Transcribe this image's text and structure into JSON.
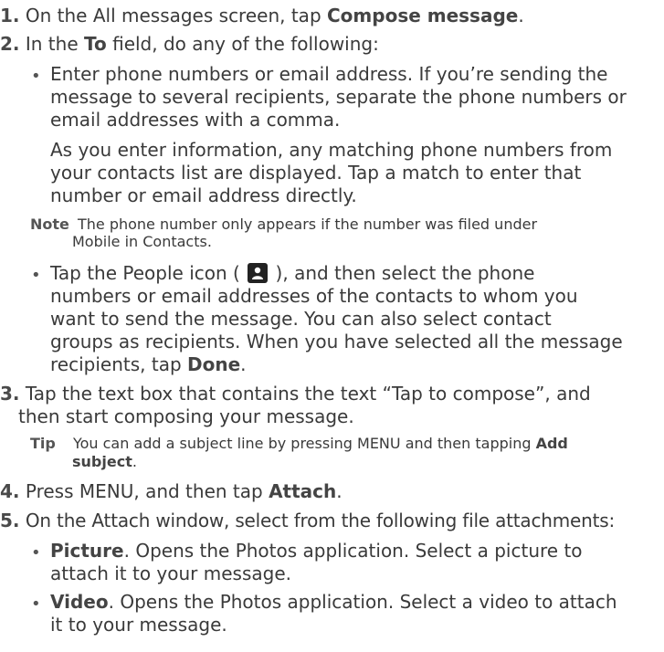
{
  "steps": {
    "s1_num": "1.",
    "s1_a": "On the All messages screen, tap ",
    "s1_b": "Compose message",
    "s1_c": ".",
    "s2_num": "2.",
    "s2_a": "In the ",
    "s2_b": "To",
    "s2_c": " field, do any of the following:",
    "b1_l1": "Enter phone numbers or email address. If you’re sending the",
    "b1_l2": "message to several recipients, separate the phone numbers or",
    "b1_l3": "email addresses with a comma.",
    "b1_p2_l1": "As you enter information, any matching phone numbers from",
    "b1_p2_l2": "your contacts list are displayed. Tap a match to enter that",
    "b1_p2_l3": "number or email address directly.",
    "note_label": "Note",
    "note_l1": "The phone number only appears if the number was filed under",
    "note_l2": "Mobile in Contacts.",
    "b2_l1a": "Tap the People icon (",
    "b2_l1b": "), and then select the phone",
    "b2_l2": "numbers or email addresses of the contacts to whom you",
    "b2_l3": "want to send the message. You can also select contact",
    "b2_l4": "groups as recipients. When you have selected all the message",
    "b2_l5a": "recipients, tap ",
    "b2_l5b": "Done",
    "b2_l5c": ".",
    "s3_num": "3.",
    "s3_l1": "Tap the text box that contains the text “Tap to compose”, and",
    "s3_l2": "then start composing your message.",
    "tip_label": "Tip",
    "tip_l1a": "You can add a subject line by pressing MENU and then tapping ",
    "tip_l1b": "Add",
    "tip_l2a": "subject",
    "tip_l2b": ".",
    "s4_num": "4.",
    "s4_a": "Press MENU, and then tap ",
    "s4_b": "Attach",
    "s4_c": ".",
    "s5_num": "5.",
    "s5_l1": "On the Attach window, select from the following file attachments:",
    "p_a": "Picture",
    "p_b": ". Opens the Photos application. Select a picture to",
    "p_l2": "attach it to your message.",
    "v_a": "Video",
    "v_b": ". Opens the Photos application. Select a video to attach",
    "v_l2": "it to your message."
  },
  "icons": {
    "people": "people-icon",
    "bullet": "bullet-dot"
  }
}
